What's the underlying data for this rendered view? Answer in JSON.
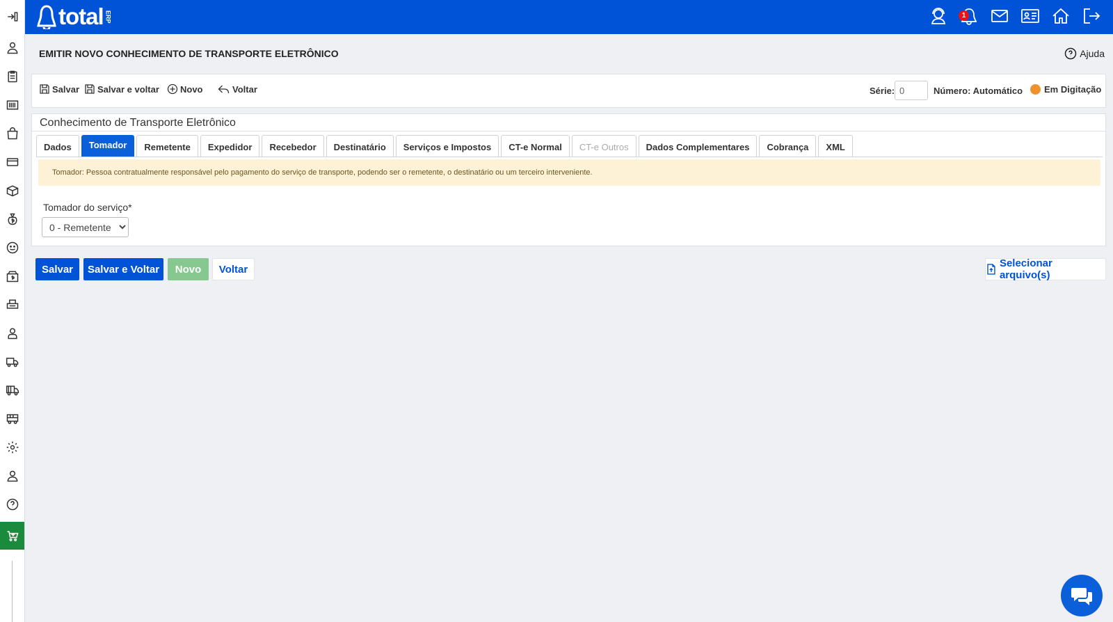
{
  "app": {
    "logo_text": "total",
    "logo_suffix": "ERP",
    "notification_count": "1"
  },
  "sidebar": {
    "icons": [
      "pin-icon",
      "users-icon",
      "clipboard-icon",
      "barcode-icon",
      "shopping-bag-icon",
      "credit-card-icon",
      "box-icon",
      "money-bag-icon",
      "smile-icon",
      "cash-box-icon",
      "printer-icon",
      "person-icon",
      "delivery-truck-icon",
      "truck-icon",
      "bus-icon",
      "gear-icon",
      "user-icon",
      "help-icon",
      "cart-icon"
    ],
    "active": "cart-icon"
  },
  "header": {
    "title": "EMITIR NOVO CONHECIMENTO DE TRANSPORTE ELETRÔNICO",
    "help_label": "Ajuda"
  },
  "toolbar": {
    "save_label": "Salvar",
    "save_back_label": "Salvar e voltar",
    "new_label": "Novo",
    "back_label": "Voltar",
    "serie_label": "Série:",
    "serie_value": "0",
    "numero_label": "Número: Automático",
    "status_label": "Em Digitação",
    "status_color": "#f0922b"
  },
  "card": {
    "title": "Conhecimento de Transporte Eletrônico",
    "tabs": [
      {
        "label": "Dados"
      },
      {
        "label": "Tomador",
        "active": true
      },
      {
        "label": "Remetente"
      },
      {
        "label": "Expedidor"
      },
      {
        "label": "Recebedor"
      },
      {
        "label": "Destinatário"
      },
      {
        "label": "Serviços e Impostos"
      },
      {
        "label": "CT-e Normal"
      },
      {
        "label": "CT-e Outros",
        "disabled": true
      },
      {
        "label": "Dados Complementares"
      },
      {
        "label": "Cobrança"
      },
      {
        "label": "XML"
      }
    ],
    "alert_text": "Tomador: Pessoa contratualmente responsável pelo pagamento do serviço de transporte, podendo ser o remetente, o destinatário ou um terceiro interveniente.",
    "field_label": "Tomador do serviço*",
    "field_value": "0 - Remetente"
  },
  "actions": {
    "save": "Salvar",
    "save_back": "Salvar e Voltar",
    "new": "Novo",
    "back": "Voltar",
    "select_files": "Selecionar arquivo(s)"
  },
  "colors": {
    "primary": "#0053d6",
    "topbar": "#0053d6",
    "active_sidebar": "#1a8a3c",
    "alert_bg": "#fdf2d6",
    "success_disabled": "#86c88f"
  }
}
